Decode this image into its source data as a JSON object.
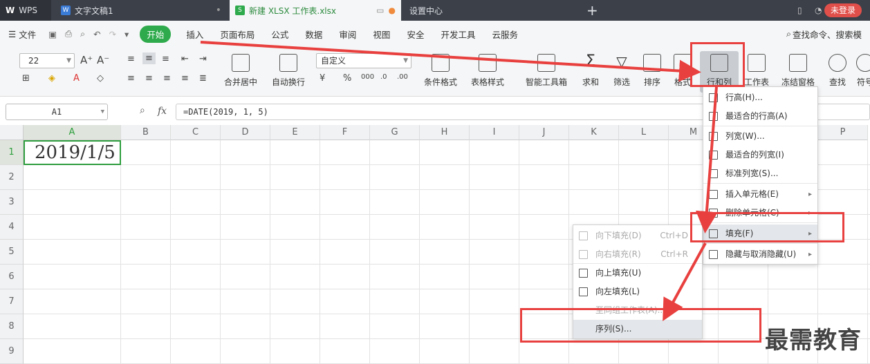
{
  "tabs": [
    {
      "label": "WPS"
    },
    {
      "label": "文字文稿1"
    },
    {
      "label": "新建 XLSX 工作表.xlsx"
    },
    {
      "label": "设置中心"
    }
  ],
  "login": "未登录",
  "menu": [
    "文件",
    "开始",
    "插入",
    "页面布局",
    "公式",
    "数据",
    "审阅",
    "视图",
    "安全",
    "开发工具",
    "云服务"
  ],
  "search": "查找命令、搜索模",
  "ribbon": {
    "font_size": "22",
    "number_format": "自定义",
    "merge": "合并居中",
    "wrap": "自动换行",
    "cond_format": "条件格式",
    "table_style": "表格样式",
    "smart_tools": "智能工具箱",
    "sum": "求和",
    "filter": "筛选",
    "sort": "排序",
    "format": "格式",
    "row_col": "行和列",
    "worksheet": "工作表",
    "freeze": "冻结窗格",
    "find": "查找",
    "symbol": "符号"
  },
  "name_box": "A1",
  "fx": "fx",
  "formula": "=DATE(2019, 1, 5)",
  "columns": [
    "A",
    "B",
    "C",
    "D",
    "E",
    "F",
    "G",
    "H",
    "I",
    "J",
    "K",
    "L",
    "M",
    "N",
    "O",
    "P"
  ],
  "rows": [
    "1",
    "2",
    "3",
    "4",
    "5",
    "6",
    "7",
    "8",
    "9"
  ],
  "cell_a1": "2019/1/5",
  "rowcol_menu": [
    {
      "label": "行高(H)..."
    },
    {
      "label": "最适合的行高(A)"
    },
    {
      "label": "列宽(W)..."
    },
    {
      "label": "最适合的列宽(I)"
    },
    {
      "label": "标准列宽(S)..."
    },
    {
      "label": "插入单元格(E)"
    },
    {
      "label": "删除单元格(C)"
    },
    {
      "label": "填充(F)"
    },
    {
      "label": "隐藏与取消隐藏(U)"
    }
  ],
  "fill_menu": [
    {
      "label": "向下填充(D)",
      "shortcut": "Ctrl+D"
    },
    {
      "label": "向右填充(R)",
      "shortcut": "Ctrl+R"
    },
    {
      "label": "向上填充(U)",
      "shortcut": ""
    },
    {
      "label": "向左填充(L)",
      "shortcut": ""
    },
    {
      "label": "至同组工作表(A)...",
      "shortcut": ""
    },
    {
      "label": "序列(S)...",
      "shortcut": ""
    }
  ],
  "watermark": "最需教育",
  "colors": {
    "accent": "#2eaa4c",
    "highlight": "#e8403e",
    "tabbar": "#3c4049"
  }
}
